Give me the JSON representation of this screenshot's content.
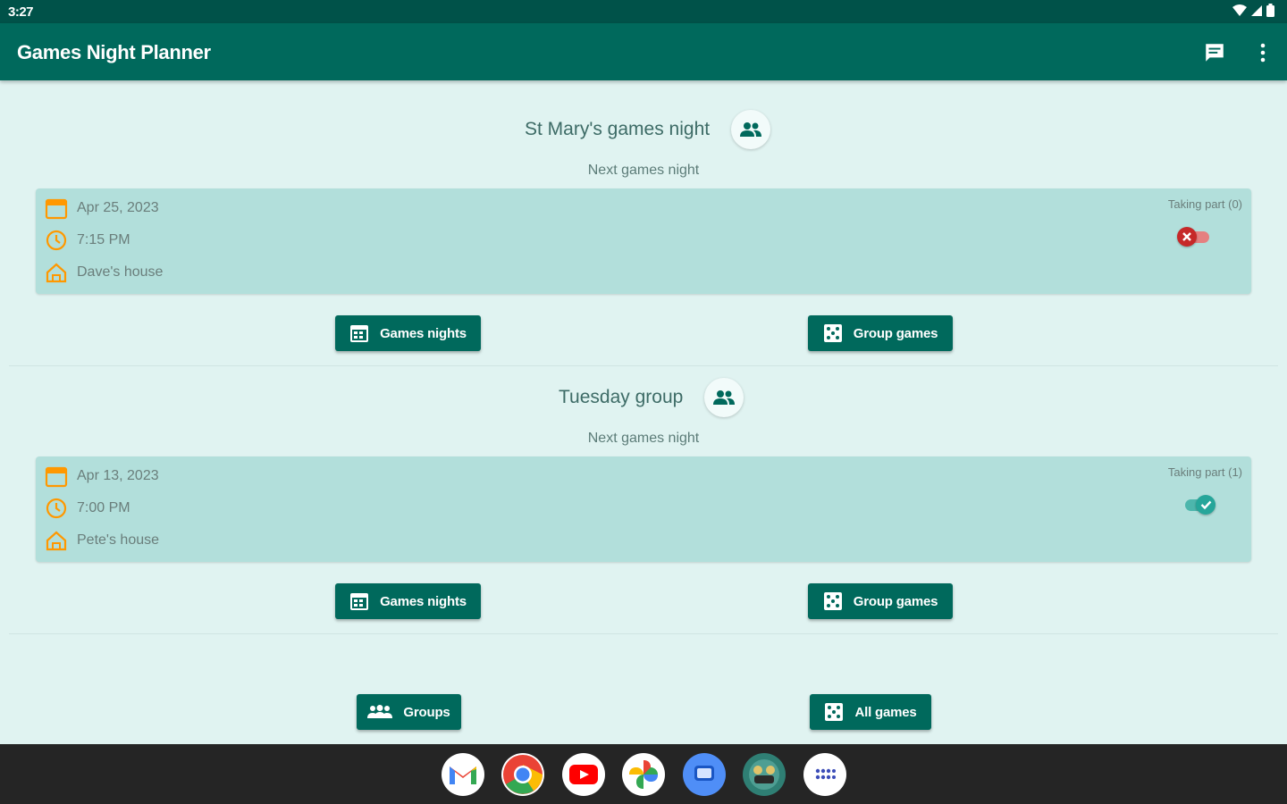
{
  "status_bar": {
    "time": "3:27"
  },
  "app_bar": {
    "title": "Games Night Planner",
    "actions": [
      "chat-icon",
      "more-vert-icon"
    ]
  },
  "groups": [
    {
      "name": "St Mary's games night",
      "next_label": "Next games night",
      "date": "Apr 25, 2023",
      "time": "7:15 PM",
      "location": "Dave's house",
      "taking_part_label": "Taking part (0)",
      "taking_part": false,
      "games_nights_label": "Games nights",
      "group_games_label": "Group games"
    },
    {
      "name": "Tuesday group",
      "next_label": "Next games night",
      "date": "Apr 13, 2023",
      "time": "7:00 PM",
      "location": "Pete's house",
      "taking_part_label": "Taking part (1)",
      "taking_part": true,
      "games_nights_label": "Games nights",
      "group_games_label": "Group games"
    }
  ],
  "bottom_actions": {
    "groups_label": "Groups",
    "all_games_label": "All games"
  },
  "dock": [
    "gmail-icon",
    "chrome-icon",
    "youtube-icon",
    "photos-icon",
    "messages-icon",
    "games-night-app-icon",
    "app-drawer-icon"
  ],
  "colors": {
    "primary": "#00695c",
    "status_bar": "#005249",
    "card": "#b2dfdb",
    "background": "#e0f3f1",
    "accent_orange": "#ff9800",
    "off_red": "#c62828",
    "on_teal": "#26a69a"
  }
}
